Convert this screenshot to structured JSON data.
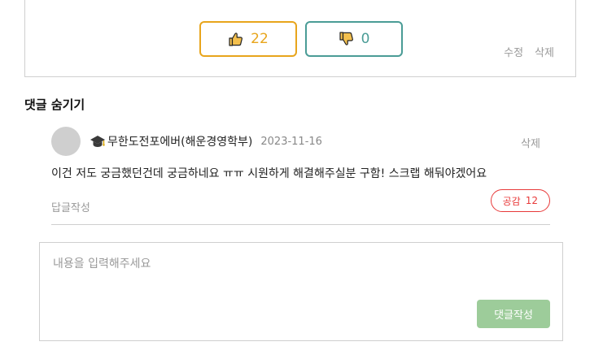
{
  "post": {
    "like_count": "22",
    "dislike_count": "0",
    "edit_label": "수정",
    "delete_label": "삭제",
    "colors": {
      "like": "#e8a51c",
      "dislike": "#4a9c96"
    }
  },
  "comments_section": {
    "toggle_label": "댓글 숨기기"
  },
  "comment": {
    "author": "무한도전포에버(해운경영학부)",
    "date": "2023-11-16",
    "delete_label": "삭제",
    "body": "이건 저도 궁금했던건데 궁금하네요 ㅠㅠ 시원하게 해결해주실분 구함! 스크랩 해둬야겠어요",
    "reply_label": "답글작성",
    "like_label": "공감",
    "like_count": "12",
    "author_icon": "graduation-cap-icon"
  },
  "editor": {
    "placeholder": "내용을 입력해주세요",
    "value": "",
    "submit_label": "댓글작성",
    "submit_color": "#9dcc9a"
  }
}
